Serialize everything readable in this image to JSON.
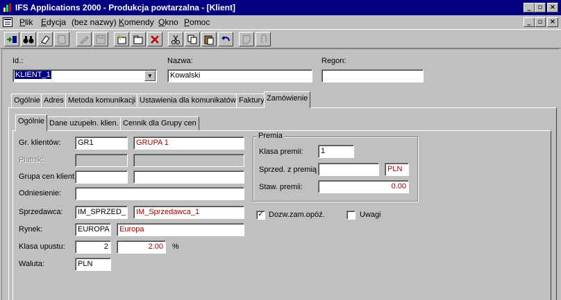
{
  "window": {
    "title": "IFS Applications 2000 - Produkcja powtarzalna - [Klient]",
    "title_color": "#000080"
  },
  "menu": [
    "Plik",
    "Edycja",
    "(bez nazwy)",
    "Komendy",
    "Okno",
    "Pomoc"
  ],
  "header": {
    "id_label": "Id.:",
    "id_value": "KLIENT_1",
    "nazwa_label": "Nazwa:",
    "nazwa_value": "Kowalski",
    "regon_label": "Regon:",
    "regon_value": ""
  },
  "main_tabs": [
    "Ogólnie",
    "Adres",
    "Metoda komunikacji",
    "Ustawienia dla komunikatów",
    "Faktury",
    "Zamówienie"
  ],
  "main_tab_active": "Zamówienie",
  "sub_tabs": [
    "Ogólnie",
    "Dane uzupełn. klien.",
    "Cennik dla Grupy cen"
  ],
  "sub_tab_active": "Ogólnie",
  "form": {
    "gr_klientow_label": "Gr. klientów:",
    "gr_klientow_code": "GR1",
    "gr_klientow_desc": "GRUPA 1",
    "platnik_label": "Płatnik:",
    "platnik_code": "",
    "platnik_desc": "",
    "grupa_cen_label": "Grupa cen klient",
    "grupa_cen_code": "",
    "grupa_cen_desc": "",
    "odniesienie_label": "Odniesienie:",
    "odniesienie_value": "",
    "sprzedawca_label": "Sprzedawca:",
    "sprzedawca_code": "IM_SPRZED_",
    "sprzedawca_desc": "IM_Sprzedawca_1",
    "rynek_label": "Rynek:",
    "rynek_code": "EUROPA",
    "rynek_desc": "Europa",
    "klasa_upustu_label": "Klasa upustu:",
    "klasa_upustu_value": "2",
    "klasa_upustu_pct": "2.00",
    "pct_symbol": "%",
    "waluta_label": "Waluta:",
    "waluta_value": "PLN"
  },
  "premia": {
    "title": "Premia",
    "klasa_label": "Klasa premii:",
    "klasa_value": "1",
    "sprzed_label": "Sprzed. z premią",
    "sprzed_value": "",
    "sprzed_currency": "PLN",
    "staw_label": "Staw. premii:",
    "staw_value": "0.00"
  },
  "checks": {
    "dozw_label": "Dozw.zam.opóź.",
    "dozw_checked": true,
    "uwagi_label": "Uwagi",
    "uwagi_checked": false
  },
  "colors": {
    "desc_text": "#a00000",
    "face": "#c0c0c0"
  }
}
